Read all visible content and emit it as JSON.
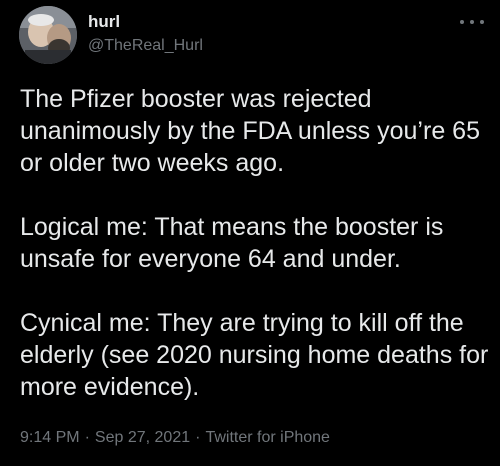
{
  "author": {
    "display_name": "hurl",
    "handle": "@TheReal_Hurl"
  },
  "tweet": {
    "paragraphs": [
      "The Pfizer booster was rejected unanimously by the FDA unless you’re 65 or older two weeks ago.",
      "Logical me:  That means the booster is unsafe for everyone 64 and under.",
      "Cynical me:  They are trying to kill off the elderly  (see 2020 nursing home deaths for more evidence)."
    ]
  },
  "meta": {
    "time": "9:14 PM",
    "separator": "·",
    "date": "Sep 27, 2021",
    "source": "Twitter for iPhone"
  },
  "icons": {
    "more": "more-horizontal-icon",
    "avatar": "profile-photo"
  },
  "colors": {
    "background": "#000000",
    "primary_text": "#e7e9ea",
    "secondary_text": "#71767b"
  }
}
